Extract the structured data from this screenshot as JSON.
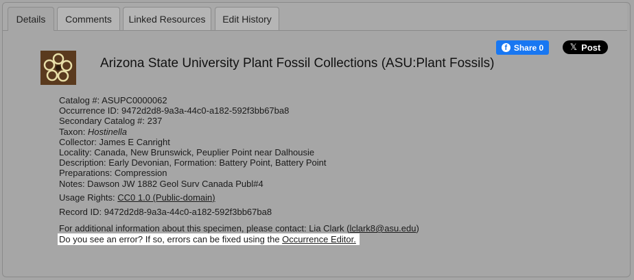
{
  "tabs": [
    "Details",
    "Comments",
    "Linked Resources",
    "Edit History"
  ],
  "header": {
    "collection_title": "Arizona State University Plant Fossil Collections (ASU:Plant Fossils)",
    "share_label": "Share 0",
    "post_label": "Post"
  },
  "fields": {
    "catalog": "Catalog #: ASUPC0000062",
    "occurrence_id": "Occurrence ID: 9472d2d8-9a3a-44c0-a182-592f3bb67ba8",
    "secondary_catalog": "Secondary Catalog #: 237",
    "taxon_label": "Taxon: ",
    "taxon_value": "Hostinella",
    "collector": "Collector: James E Canright",
    "locality": "Locality: Canada, New Brunswick, Peuplier Point near Dalhousie",
    "description": "Description: Early Devonian, Formation: Battery Point, Battery Point",
    "preparations": "Preparations: Compression",
    "notes": "Notes: Dawson JW 1882 Geol Surv Canada Publ#4"
  },
  "usage": {
    "label": "Usage Rights: ",
    "link": "CC0 1.0 (Public-domain)"
  },
  "record_id": "Record ID: 9472d2d8-9a3a-44c0-a182-592f3bb67ba8",
  "contact": {
    "text": "For additional information about this specimen, please contact: Lia Clark (",
    "email": "lclark8@asu.edu",
    "close": ")"
  },
  "error": {
    "text": "Do you see an error? If so, errors can be fixed using the ",
    "link": "Occurrence Editor."
  }
}
